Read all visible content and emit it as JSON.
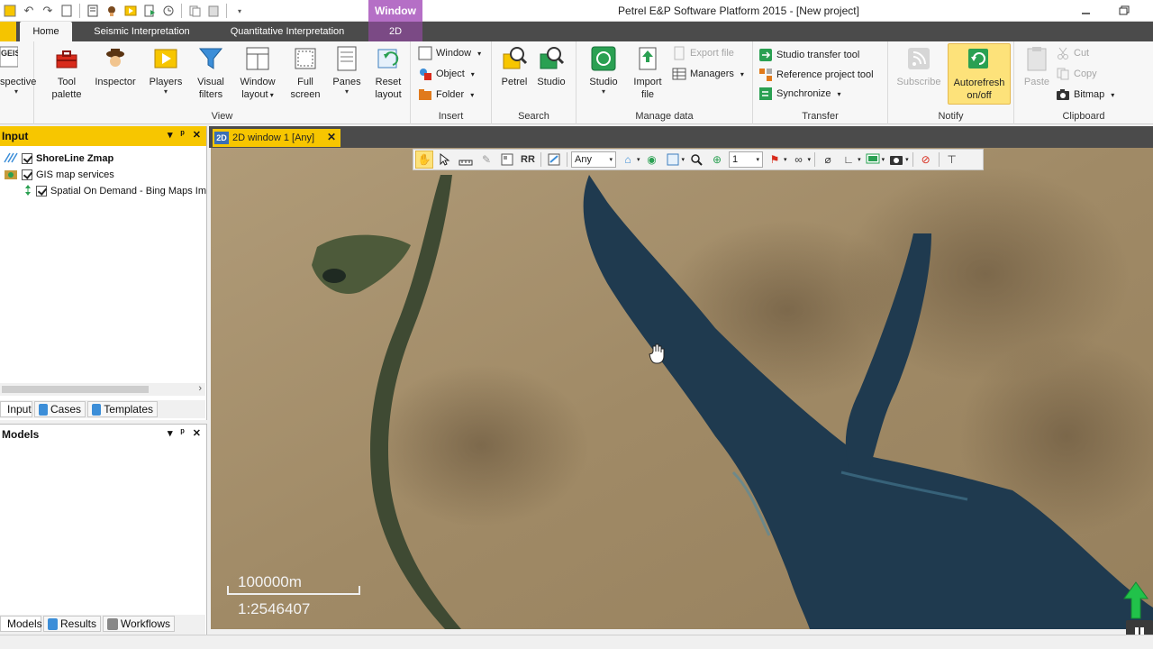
{
  "window": {
    "title": "Petrel E&P Software Platform 2015 - [New project]",
    "context_tab_group": "Window"
  },
  "tabs": {
    "home": "Home",
    "seismic": "Seismic Interpretation",
    "quant": "Quantitative Interpretation",
    "twod": "2D"
  },
  "ribbon": {
    "perspective": {
      "line1": "GEIS",
      "line2": "spective"
    },
    "view": {
      "label": "View",
      "tool_palette": [
        "Tool",
        "palette"
      ],
      "inspector": "Inspector",
      "players": "Players",
      "visual_filters": [
        "Visual",
        "filters"
      ],
      "window_layout": [
        "Window",
        "layout"
      ],
      "full_screen": [
        "Full",
        "screen"
      ],
      "panes": "Panes",
      "reset_layout": [
        "Reset",
        "layout"
      ]
    },
    "insert": {
      "label": "Insert",
      "window": "Window",
      "object": "Object",
      "folder": "Folder"
    },
    "search": {
      "label": "Search",
      "petrel": "Petrel",
      "studio": "Studio"
    },
    "manage": {
      "label": "Manage data",
      "studio": "Studio",
      "import_file": [
        "Import",
        "file"
      ],
      "export_file": "Export file",
      "managers": "Managers"
    },
    "transfer": {
      "label": "Transfer",
      "studio_transfer": "Studio transfer tool",
      "reference_project": "Reference project tool",
      "synchronize": "Synchronize"
    },
    "notify": {
      "label": "Notify",
      "subscribe": "Subscribe",
      "autorefresh": [
        "Autorefresh",
        "on/off"
      ]
    },
    "clipboard": {
      "label": "Clipboard",
      "paste": "Paste",
      "cut": "Cut",
      "copy": "Copy",
      "bitmap": "Bitmap"
    }
  },
  "input_panel": {
    "title": "Input",
    "tree": [
      {
        "label": "ShoreLine Zmap",
        "checked": true
      },
      {
        "label": "GIS map services",
        "checked": true
      },
      {
        "label": "Spatial On Demand - Bing Maps Im",
        "checked": true
      }
    ],
    "tabs": [
      "Input",
      "Cases",
      "Templates"
    ]
  },
  "models_panel": {
    "title": "Models",
    "tabs": [
      "Models",
      "Results",
      "Workflows"
    ]
  },
  "document": {
    "tab_badge": "2D",
    "tab_label": "2D window 1 [Any]"
  },
  "map_toolbar": {
    "domain_select": "Any",
    "zoom_value": "1"
  },
  "map": {
    "scale_distance": "100000m",
    "scale_ratio": "1:2546407"
  },
  "colors": {
    "accent_yellow": "#f7c600",
    "ribbon_dark": "#4b4b4b",
    "context_purple": "#b56fc6",
    "desert": "#a58d69",
    "sea": "#1f3a4f"
  }
}
